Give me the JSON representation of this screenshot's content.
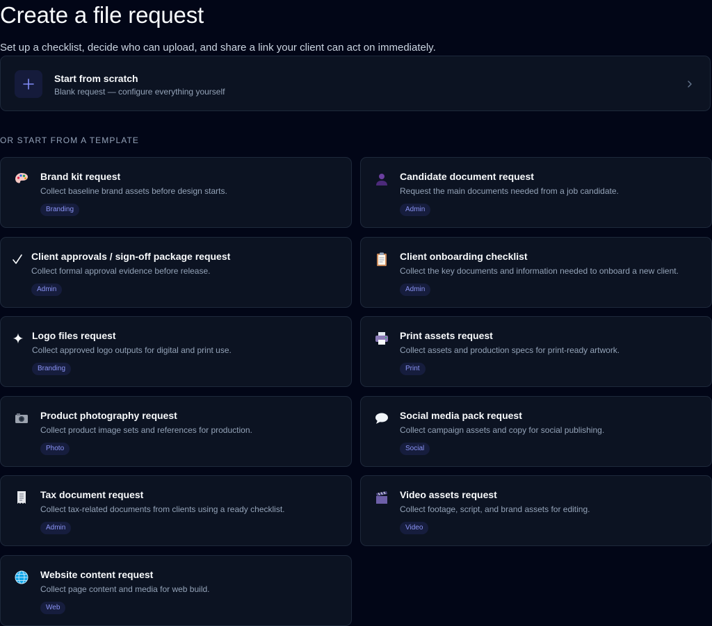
{
  "header": {
    "title": "Create a file request",
    "subtitle": "Set up a checklist, decide who can upload, and share a link your client can act on immediately."
  },
  "scratch": {
    "title": "Start from scratch",
    "description": "Blank request — configure everything yourself",
    "icon": "plus-icon"
  },
  "section_label": "OR START FROM A TEMPLATE",
  "colors": {
    "background": "#020617",
    "card": "#0c1322",
    "border": "#1e293b",
    "badge_bg": "#161d3d",
    "badge_text": "#8b94f5"
  },
  "templates": [
    {
      "title": "Brand kit request",
      "description": "Collect baseline brand assets before design starts.",
      "badge": "Branding",
      "icon": "palette-icon"
    },
    {
      "title": "Candidate document request",
      "description": "Request the main documents needed from a job candidate.",
      "badge": "Admin",
      "icon": "person-icon"
    },
    {
      "title": "Client approvals / sign-off package request",
      "description": "Collect formal approval evidence before release.",
      "badge": "Admin",
      "icon": "checkmark-icon"
    },
    {
      "title": "Client onboarding checklist",
      "description": "Collect the key documents and information needed to onboard a new client.",
      "badge": "Admin",
      "icon": "clipboard-icon"
    },
    {
      "title": "Logo files request",
      "description": "Collect approved logo outputs for digital and print use.",
      "badge": "Branding",
      "icon": "sparkle-icon"
    },
    {
      "title": "Print assets request",
      "description": "Collect assets and production specs for print-ready artwork.",
      "badge": "Print",
      "icon": "printer-icon"
    },
    {
      "title": "Product photography request",
      "description": "Collect product image sets and references for production.",
      "badge": "Photo",
      "icon": "camera-icon"
    },
    {
      "title": "Social media pack request",
      "description": "Collect campaign assets and copy for social publishing.",
      "badge": "Social",
      "icon": "speech-bubble-icon"
    },
    {
      "title": "Tax document request",
      "description": "Collect tax-related documents from clients using a ready checklist.",
      "badge": "Admin",
      "icon": "receipt-icon"
    },
    {
      "title": "Video assets request",
      "description": "Collect footage, script, and brand assets for editing.",
      "badge": "Video",
      "icon": "clapperboard-icon"
    },
    {
      "title": "Website content request",
      "description": "Collect page content and media for web build.",
      "badge": "Web",
      "icon": "globe-icon"
    }
  ]
}
